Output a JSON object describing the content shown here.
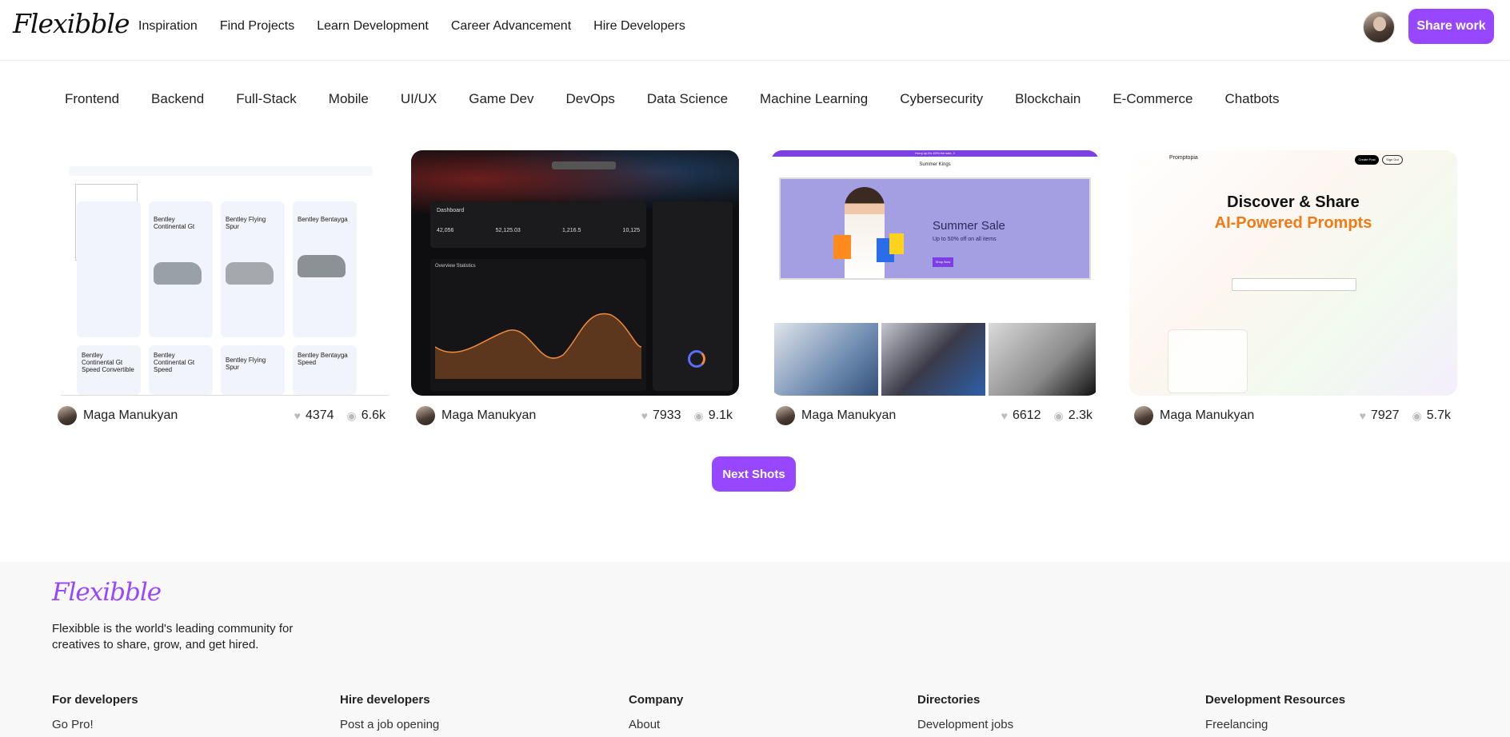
{
  "header": {
    "logo": "Flexibble",
    "nav": [
      "Inspiration",
      "Find Projects",
      "Learn Development",
      "Career Advancement",
      "Hire Developers"
    ],
    "share_label": "Share work"
  },
  "categories": [
    "Frontend",
    "Backend",
    "Full-Stack",
    "Mobile",
    "UI/UX",
    "Game Dev",
    "DevOps",
    "Data Science",
    "Machine Learning",
    "Cybersecurity",
    "Blockchain",
    "E-Commerce",
    "Chatbots"
  ],
  "projects": [
    {
      "author": "Maga Manukyan",
      "likes": "4374",
      "views": "6.6k",
      "thumb": {
        "cars": [
          "Bentley Continental Gt",
          "Bentley Flying Spur",
          "Bentley Bentayga",
          "Bentley Continental Gt Speed Convertible",
          "Bentley Continental Gt Speed",
          "Bentley Flying Spur",
          "Bentley Bentayga Speed"
        ]
      }
    },
    {
      "author": "Maga Manukyan",
      "likes": "7933",
      "views": "9.1k",
      "thumb": {
        "title": "Dashboard",
        "values": [
          "42,056",
          "52,125.03",
          "1,216.5",
          "10,125"
        ],
        "section": "Overview Statistics"
      }
    },
    {
      "author": "Maga Manukyan",
      "likes": "6612",
      "views": "2.3k",
      "thumb": {
        "banner": "Hurry up it's 40% the sale, !!",
        "store": "Summer Kings",
        "headline": "Summer Sale",
        "sub": "Up to 50% off on all items",
        "cta": "Shop Now"
      }
    },
    {
      "author": "Maga Manukyan",
      "likes": "7927",
      "views": "5.7k",
      "thumb": {
        "brand": "Promptopia",
        "h1": "Discover & Share",
        "h2": "AI-Powered Prompts",
        "create": "Create Post",
        "signout": "Sign Out"
      }
    }
  ],
  "next_label": "Next Shots",
  "footer": {
    "logo": "Flexibble",
    "tagline": "Flexibble is the world's leading community for creatives to share, grow, and get hired.",
    "columns": [
      {
        "title": "For developers",
        "item": "Go Pro!"
      },
      {
        "title": "Hire developers",
        "item": "Post a job opening"
      },
      {
        "title": "Company",
        "item": "About"
      },
      {
        "title": "Directories",
        "item": "Development jobs"
      },
      {
        "title": "Development Resources",
        "item": "Freelancing"
      }
    ]
  },
  "colors": {
    "accent": "#9747ff"
  }
}
